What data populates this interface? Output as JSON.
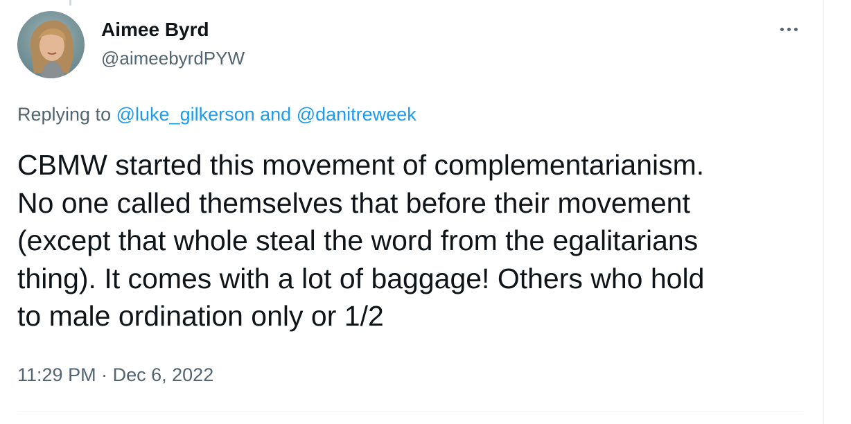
{
  "author": {
    "display_name": "Aimee Byrd",
    "handle": "@aimeebyrdPYW",
    "avatar_icon": "profile-photo"
  },
  "more_icon": "ellipsis-icon",
  "reply_context": {
    "prefix": "Replying to",
    "mention_1": "@luke_gilkerson",
    "conjunction": "and",
    "mention_2": "@danitreweek"
  },
  "tweet": {
    "text": "CBMW started this movement of complementarianism.\nNo one called themselves that before their movement\n(except that whole steal the word from the egalitarians\nthing). It comes with a lot of baggage! Others who hold\nto male ordination only or 1/2"
  },
  "meta": {
    "time": "11:29 PM",
    "separator": "·",
    "date": "Dec 6, 2022"
  },
  "colors": {
    "text_primary": "#0f1419",
    "text_secondary": "#536471",
    "link": "#1d9bf0",
    "border": "#eff3f4"
  }
}
